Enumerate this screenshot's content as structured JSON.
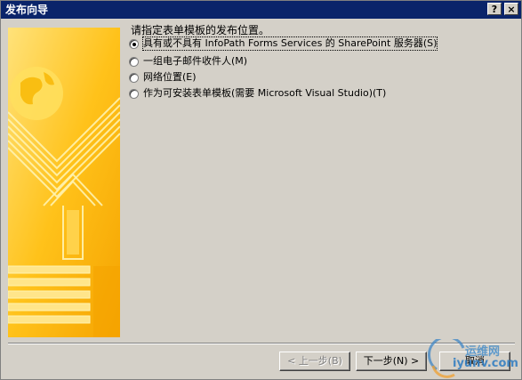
{
  "window": {
    "title": "发布向导",
    "help_label": "?",
    "close_label": "×"
  },
  "prompt": "请指定表单模板的发布位置。",
  "options": [
    {
      "label": "具有或不具有 InfoPath Forms Services 的 SharePoint 服务器(S)",
      "selected": true
    },
    {
      "label": "一组电子邮件收件人(M)",
      "selected": false
    },
    {
      "label": "网络位置(E)",
      "selected": false
    },
    {
      "label": "作为可安装表单模板(需要 Microsoft Visual Studio)(T)",
      "selected": false
    }
  ],
  "buttons": {
    "back": "< 上一步(B)",
    "next": "下一步(N) >",
    "cancel": "取消"
  },
  "watermark": {
    "line1": "运维网",
    "line2": "iyunv.com"
  },
  "colors": {
    "titlebar": "#0a246a",
    "dialog_bg": "#d4d0c8",
    "banner_orange": "#f5a800",
    "banner_yellow": "#ffd84a"
  }
}
